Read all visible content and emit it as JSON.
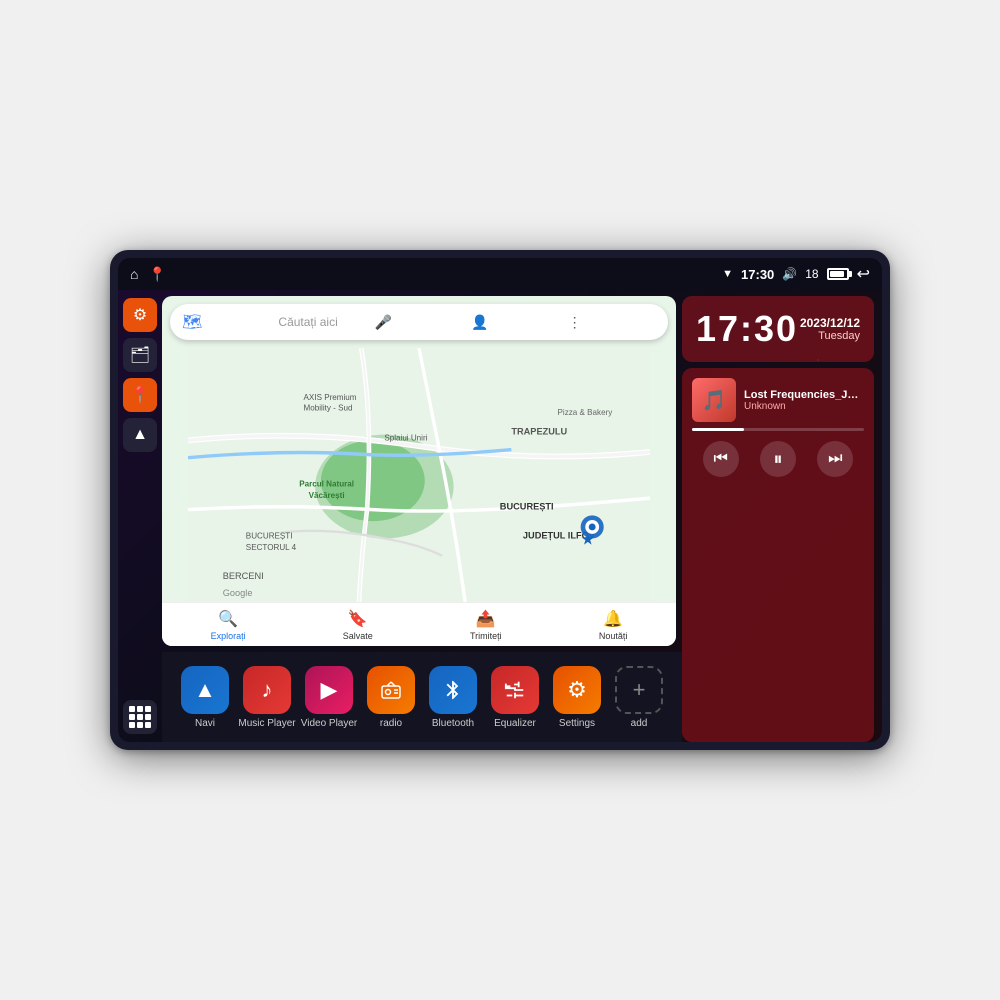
{
  "device": {
    "status_bar": {
      "left_icons": [
        "home",
        "location"
      ],
      "time": "17:30",
      "signal": "▼",
      "volume": "🔊",
      "battery_level": "18",
      "back": "↩"
    },
    "clock": {
      "time": "17:30",
      "date": "2023/12/12",
      "day": "Tuesday"
    },
    "music": {
      "title": "Lost Frequencies_Janie...",
      "artist": "Unknown",
      "thumbnail_emoji": "🎵",
      "progress": "30"
    },
    "map": {
      "search_placeholder": "Căutați aici",
      "places": [
        "AXIS Premium Mobility - Sud",
        "Pizza & Bakery",
        "Parcul Natural Văcărești",
        "BUCUREȘTI SECTORUL 4",
        "BUCUREȘTI",
        "JUDEȚUL ILFOV",
        "BERCENI",
        "Splaiui Uniri",
        "TRAPEZULU"
      ],
      "bottom_tabs": [
        "Explorați",
        "Salvate",
        "Trimiteți",
        "Noutăți"
      ]
    },
    "apps": [
      {
        "id": "navi",
        "label": "Navi",
        "icon": "▲",
        "color_class": "icon-navi"
      },
      {
        "id": "music-player",
        "label": "Music Player",
        "icon": "♪",
        "color_class": "icon-music"
      },
      {
        "id": "video-player",
        "label": "Video Player",
        "icon": "▶",
        "color_class": "icon-video"
      },
      {
        "id": "radio",
        "label": "radio",
        "icon": "📻",
        "color_class": "icon-radio"
      },
      {
        "id": "bluetooth",
        "label": "Bluetooth",
        "icon": "⚡",
        "color_class": "icon-bluetooth"
      },
      {
        "id": "equalizer",
        "label": "Equalizer",
        "icon": "🎚",
        "color_class": "icon-equalizer"
      },
      {
        "id": "settings",
        "label": "Settings",
        "icon": "⚙",
        "color_class": "icon-settings"
      },
      {
        "id": "add",
        "label": "add",
        "icon": "+",
        "color_class": "icon-add"
      }
    ],
    "sidebar": {
      "settings_label": "Settings",
      "folder_label": "Folder",
      "map_label": "Map",
      "nav_label": "Navigation",
      "apps_label": "Apps"
    }
  }
}
